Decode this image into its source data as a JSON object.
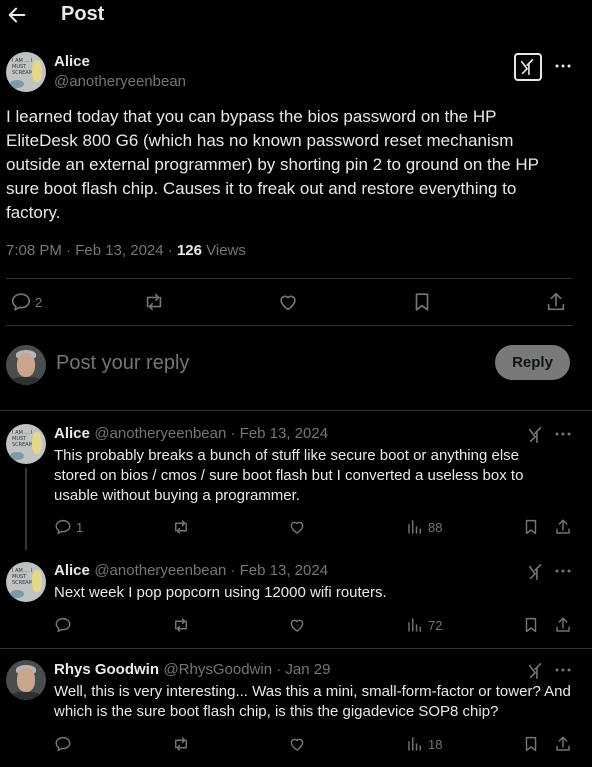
{
  "header": {
    "title": "Post"
  },
  "post": {
    "author_name": "Alice",
    "author_handle": "@anotheryeenbean",
    "body": "I learned today that you can bypass the bios password on the HP EliteDesk 800 G6 (which has no known password reset mechanism outside an external programmer) by shorting pin 2 to ground on the HP sure boot flash chip. Causes it to freak out and restore everything to factory.",
    "time": "7:08 PM · Feb 13, 2024 · ",
    "views_count": "126",
    "views_label": " Views",
    "reply_count": "2",
    "avatar_text": "I AM ... I MUST SCREAM"
  },
  "composer": {
    "placeholder": "Post your reply",
    "button_label": "Reply"
  },
  "replies": [
    {
      "author_name": "Alice",
      "handle_date": "@anotheryeenbean · Feb 13, 2024",
      "body": "This probably breaks a bunch of stuff like secure boot or anything else stored on bios / cmos / sure boot flash but I converted a useless box to usable without buying a programmer.",
      "reply_count": "1",
      "views": "88"
    },
    {
      "author_name": "Alice",
      "handle_date": "@anotheryeenbean · Feb 13, 2024",
      "body": "Next week I pop popcorn using 12000 wifi routers.",
      "reply_count": "",
      "views": "72"
    },
    {
      "author_name": "Rhys Goodwin",
      "handle_date": "@RhysGoodwin · Jan 29",
      "body": "Well, this is very interesting... Was this a mini, small-form-factor or tower? And which is the sure boot flash chip, is this the gigadevice SOP8 chip?",
      "reply_count": "",
      "views": "18"
    }
  ],
  "colors": {
    "background": "#000000",
    "text": "#e7e9ea",
    "muted": "#71767b",
    "divider": "#2f3336",
    "reply_button": "#787a7a"
  }
}
